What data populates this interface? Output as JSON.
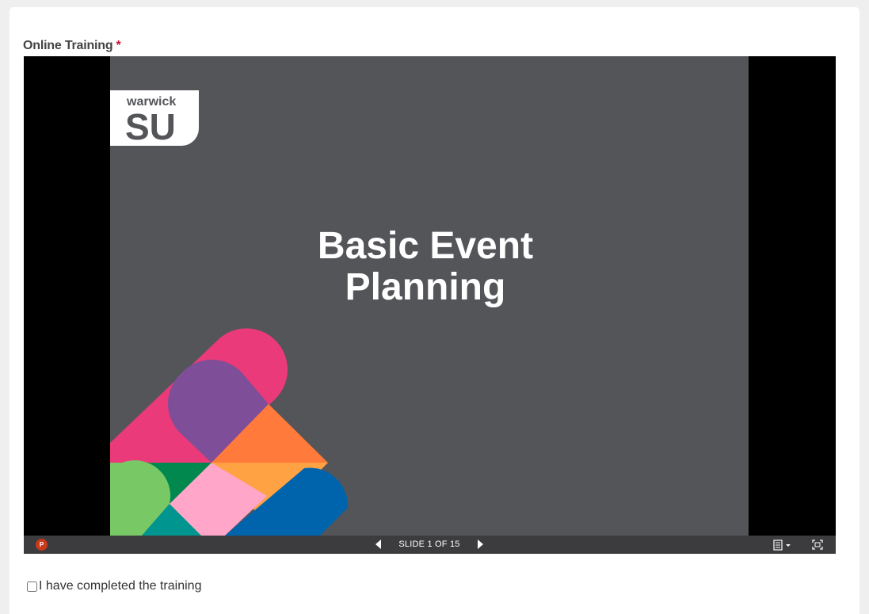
{
  "form": {
    "field_label": "Online Training",
    "required_marker": "*"
  },
  "slide": {
    "logo_text": "warwick",
    "logo_mark": "SU",
    "title_line1": "Basic Event",
    "title_line2": "Planning",
    "colors": {
      "slide_bg": "#545559",
      "pink": "#ea3a7a",
      "purple": "#7e4f98",
      "orange": "#ff7a3b",
      "light_orange": "#ffa243",
      "green": "#00884e",
      "light_green": "#79c866",
      "light_pink": "#ffa6c9",
      "teal": "#00968f",
      "blue": "#0064ad"
    }
  },
  "player": {
    "slide_counter": "SLIDE 1 OF 15",
    "app_icon": "powerpoint-icon",
    "prev_icon": "triangle-left-icon",
    "next_icon": "triangle-right-icon",
    "notes_icon": "notes-menu-icon",
    "fullscreen_icon": "fullscreen-icon"
  },
  "consent": {
    "label": "I have completed the training",
    "checked": false
  }
}
